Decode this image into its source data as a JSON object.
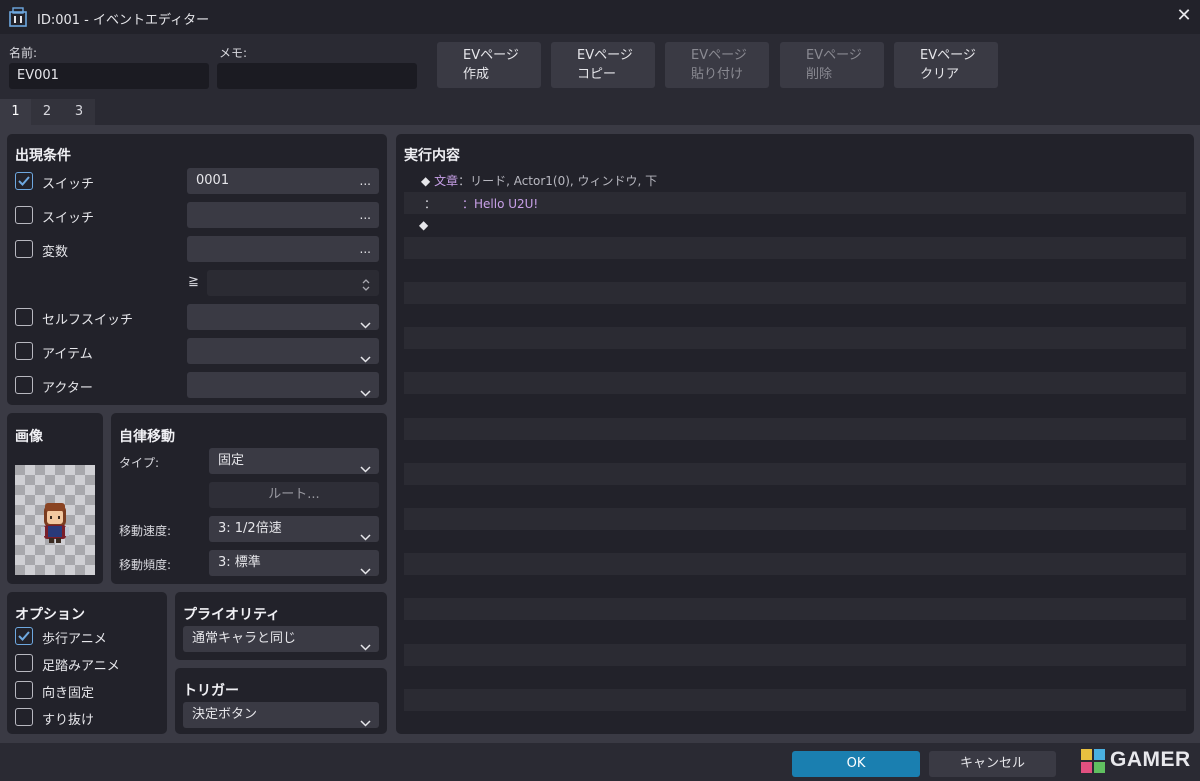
{
  "window": {
    "title": "ID:001 - イベントエディター",
    "close_glyph": "✕"
  },
  "header": {
    "name_label": "名前:",
    "name_value": "EV001",
    "memo_label": "メモ:",
    "memo_value": ""
  },
  "ev_buttons": [
    {
      "line1": "EVページ",
      "line2": "作成",
      "enabled": true
    },
    {
      "line1": "EVページ",
      "line2": "コピー",
      "enabled": true
    },
    {
      "line1": "EVページ",
      "line2": "貼り付け",
      "enabled": false
    },
    {
      "line1": "EVページ",
      "line2": "削除",
      "enabled": false
    },
    {
      "line1": "EVページ",
      "line2": "クリア",
      "enabled": true
    }
  ],
  "tabs": [
    "1",
    "2",
    "3"
  ],
  "conditions": {
    "title": "出現条件",
    "switch1": {
      "label": "スイッチ",
      "checked": true,
      "value": "0001"
    },
    "switch2": {
      "label": "スイッチ",
      "checked": false,
      "value": ""
    },
    "variable": {
      "label": "変数",
      "checked": false,
      "value": ""
    },
    "compare_symbol": "≧",
    "compare_value": "",
    "self_switch": {
      "label": "セルフスイッチ",
      "checked": false,
      "value": ""
    },
    "item": {
      "label": "アイテム",
      "checked": false,
      "value": ""
    },
    "actor": {
      "label": "アクター",
      "checked": false,
      "value": ""
    },
    "dots": "..."
  },
  "image": {
    "title": "画像"
  },
  "movement": {
    "title": "自律移動",
    "type_label": "タイプ:",
    "type_value": "固定",
    "route_button": "ルート...",
    "speed_label": "移動速度:",
    "speed_value": "3: 1/2倍速",
    "freq_label": "移動頻度:",
    "freq_value": "3: 標準"
  },
  "options": {
    "title": "オプション",
    "items": [
      {
        "label": "歩行アニメ",
        "checked": true
      },
      {
        "label": "足踏みアニメ",
        "checked": false
      },
      {
        "label": "向き固定",
        "checked": false
      },
      {
        "label": "すり抜け",
        "checked": false
      }
    ]
  },
  "priority": {
    "title": "プライオリティ",
    "value": "通常キャラと同じ"
  },
  "trigger": {
    "title": "トリガー",
    "value": "決定ボタン"
  },
  "commands": {
    "title": "実行内容",
    "line1_prefix": "◆",
    "line1_cmd": "文章",
    "line1_args": "：リード, Actor1(0), ウィンドウ, 下",
    "line2_prefix": "：",
    "line2_args": "：Hello U2U!",
    "line3_prefix": "◆"
  },
  "footer": {
    "ok_label": "OK",
    "cancel_label": "キャンセル"
  },
  "watermark": {
    "text": "GAMER"
  },
  "colors": {
    "accent": "#1a7fb0",
    "checkbox_check": "#6ea8e0",
    "command_text": "#c8a0e8"
  }
}
